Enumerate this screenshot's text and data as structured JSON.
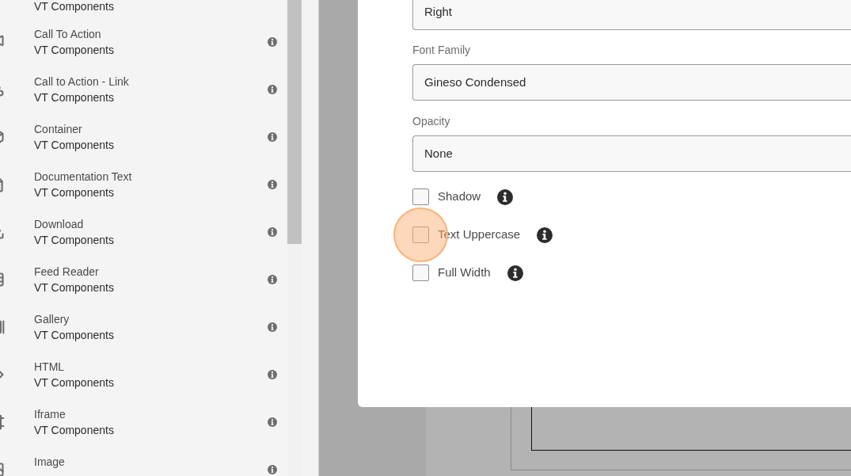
{
  "sidebar": {
    "items": [
      {
        "subtitle": "VT Components"
      },
      {
        "title": "Call To Action",
        "subtitle": "VT Components"
      },
      {
        "title": "Call to Action - Link",
        "subtitle": "VT Components"
      },
      {
        "title": "Container",
        "subtitle": "VT Components"
      },
      {
        "title": "Documentation Text",
        "subtitle": "VT Components"
      },
      {
        "title": "Download",
        "subtitle": "VT Components"
      },
      {
        "title": "Feed Reader",
        "subtitle": "VT Components"
      },
      {
        "title": "Gallery",
        "subtitle": "VT Components"
      },
      {
        "title": "HTML",
        "subtitle": "VT Components"
      },
      {
        "title": "Iframe",
        "subtitle": "VT Components"
      },
      {
        "title": "Image"
      }
    ]
  },
  "dialog": {
    "fields": [
      {
        "value": "Right"
      },
      {
        "label": "Font Family",
        "value": "Gineso Condensed"
      },
      {
        "label": "Opacity",
        "value": "None"
      }
    ],
    "checkboxes": [
      {
        "label": "Shadow",
        "checked": false,
        "highlighted": false
      },
      {
        "label": "Text Uppercase",
        "checked": false,
        "highlighted": true
      },
      {
        "label": "Full Width",
        "checked": false,
        "highlighted": false
      }
    ]
  }
}
